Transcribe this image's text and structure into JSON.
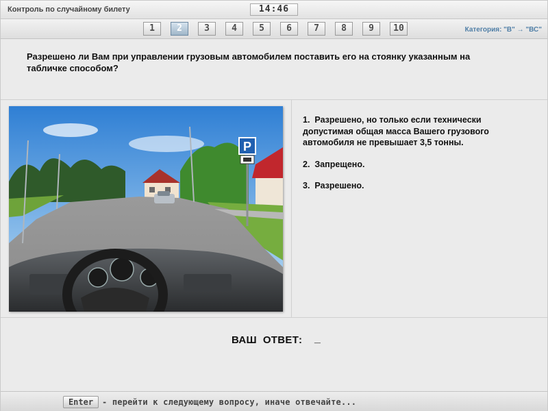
{
  "window": {
    "title": "Контроль по случайному билету",
    "timer": "14:46"
  },
  "nav": {
    "questions": [
      "1",
      "2",
      "3",
      "4",
      "5",
      "6",
      "7",
      "8",
      "9",
      "10"
    ],
    "active_question": "2",
    "category": "Категория: \"В\" → \"ВС\""
  },
  "question": {
    "text": "Разрешено ли Вам при управлении грузовым автомобилем поставить его на стоянку указанным на табличке способом?"
  },
  "answers": [
    {
      "number": "1.",
      "text": "Разрешено, но только если технически допустимая общая масса Вашего грузового автомобиля не превышает 3,5 тонны."
    },
    {
      "number": "2.",
      "text": "Запрещено."
    },
    {
      "number": "3.",
      "text": "Разрешено."
    }
  ],
  "scene": {
    "parking_sign": "P",
    "icon": "road-scene-image"
  },
  "your_answer": {
    "label": "ВАШ  ОТВЕТ:",
    "value": "_"
  },
  "hint": {
    "key": "Enter",
    "text": "- перейти к следующему вопросу, иначе отвечайте..."
  },
  "colors": {
    "accent": "#4f7ea6",
    "active_button": "#9fb6c9",
    "sign_blue": "#2060b0"
  }
}
